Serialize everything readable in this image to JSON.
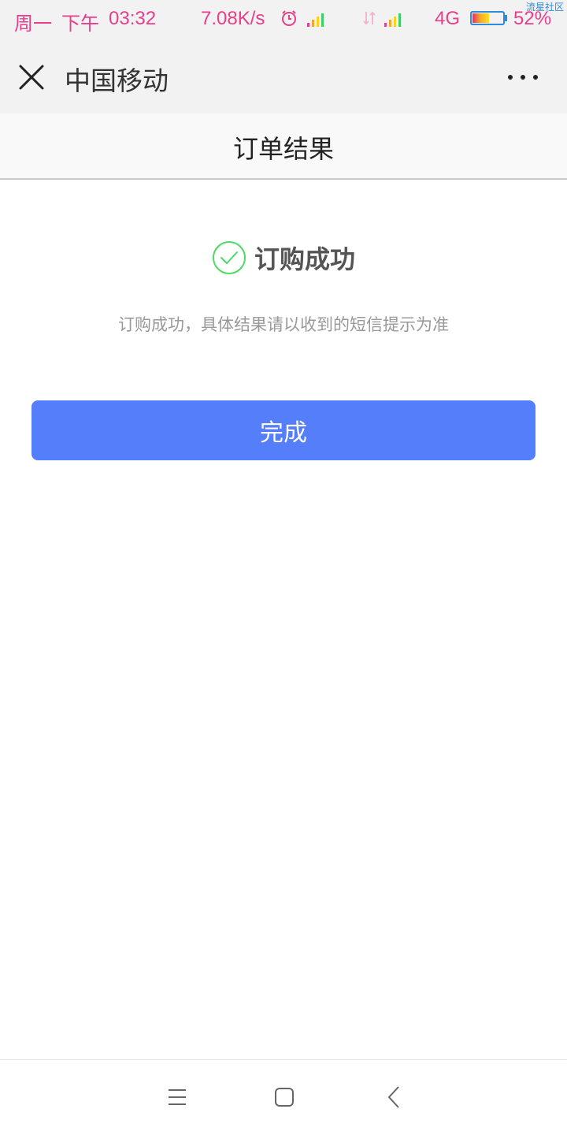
{
  "status_bar": {
    "day": "周一",
    "period": "下午",
    "time": "03:32",
    "net_speed": "7.08K/s",
    "network": "4G",
    "battery_pct": "52%",
    "battery_level": 0.52,
    "watermark": "流星社区",
    "color": "#e83e8c"
  },
  "nav": {
    "title": "中国移动",
    "close_icon": "close-icon",
    "more_icon": "more-icon"
  },
  "page": {
    "title": "订单结果"
  },
  "result": {
    "icon": "check-circle-icon",
    "title": "订购成功",
    "description": "订购成功，具体结果请以收到的短信提示为准"
  },
  "actions": {
    "done_label": "完成",
    "done_color": "#557ffa"
  },
  "system_nav": {
    "icons": [
      "menu-icon",
      "home-icon",
      "back-icon"
    ]
  }
}
